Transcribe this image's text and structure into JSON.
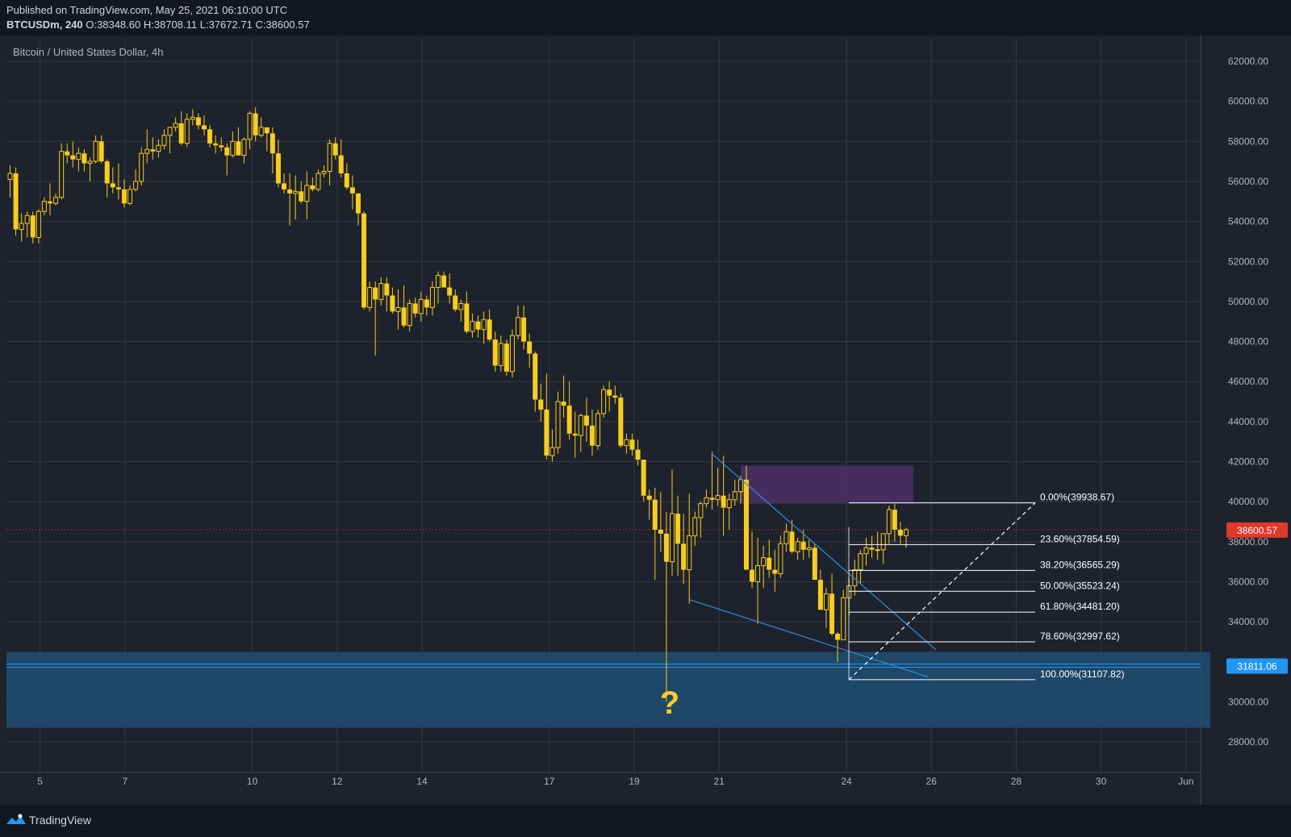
{
  "header": {
    "published": "Published on TradingView.com, May 25, 2021 06:10:00 UTC",
    "symbol": "BTCUSDm, 240",
    "o_label": "O:",
    "o": "38348.60",
    "h_label": "H:",
    "h": "38708.11",
    "l_label": "L:",
    "l": "37672.71",
    "c_label": "C:",
    "c": "38600.57"
  },
  "footer": {
    "brand": "TradingView"
  },
  "chart_data": {
    "type": "candlestick",
    "title": "Bitcoin / United States Dollar, 4h",
    "ylim": [
      27000,
      63000
    ],
    "y_ticks": [
      "62000.00",
      "60000.00",
      "58000.00",
      "56000.00",
      "54000.00",
      "52000.00",
      "50000.00",
      "48000.00",
      "46000.00",
      "44000.00",
      "42000.00",
      "40000.00",
      "38000.00",
      "36000.00",
      "34000.00",
      "32000.00",
      "30000.00",
      "28000.00"
    ],
    "x_ticks": [
      "5",
      "7",
      "10",
      "12",
      "14",
      "17",
      "19",
      "21",
      "24",
      "26",
      "28",
      "30",
      "Jun"
    ],
    "candles": [
      [
        56100,
        56800,
        55200,
        56400
      ],
      [
        56400,
        56700,
        53300,
        53600
      ],
      [
        53600,
        54400,
        53000,
        53900
      ],
      [
        53900,
        54500,
        53200,
        54300
      ],
      [
        54300,
        54500,
        52900,
        53200
      ],
      [
        53200,
        54600,
        52900,
        54500
      ],
      [
        54500,
        55200,
        54300,
        55000
      ],
      [
        55000,
        55900,
        54300,
        54900
      ],
      [
        54900,
        55400,
        54800,
        55200
      ],
      [
        55200,
        57900,
        55100,
        57500
      ],
      [
        57500,
        57900,
        56900,
        57300
      ],
      [
        57300,
        58000,
        56700,
        57100
      ],
      [
        57100,
        57700,
        56500,
        57400
      ],
      [
        57400,
        57600,
        56500,
        56900
      ],
      [
        56900,
        57200,
        56000,
        57000
      ],
      [
        57000,
        58300,
        56900,
        58000
      ],
      [
        58000,
        58300,
        56900,
        57000
      ],
      [
        57000,
        57100,
        55200,
        55900
      ],
      [
        55900,
        56700,
        55400,
        55700
      ],
      [
        55700,
        56900,
        55100,
        55600
      ],
      [
        55600,
        56100,
        54700,
        54900
      ],
      [
        54900,
        55800,
        54800,
        55600
      ],
      [
        55600,
        56600,
        55500,
        56000
      ],
      [
        56000,
        57700,
        55800,
        57400
      ],
      [
        57400,
        58600,
        56900,
        57600
      ],
      [
        57600,
        58200,
        57100,
        57500
      ],
      [
        57500,
        58100,
        57200,
        57800
      ],
      [
        57800,
        58600,
        57600,
        58300
      ],
      [
        58300,
        58700,
        57400,
        58700
      ],
      [
        58700,
        59200,
        58500,
        58900
      ],
      [
        58900,
        59500,
        57800,
        57900
      ],
      [
        57900,
        59400,
        57700,
        59100
      ],
      [
        59100,
        59600,
        58800,
        59200
      ],
      [
        59200,
        59400,
        58600,
        58800
      ],
      [
        58800,
        59300,
        58300,
        58600
      ],
      [
        58600,
        58800,
        57700,
        57900
      ],
      [
        57900,
        58300,
        57400,
        57800
      ],
      [
        57800,
        58200,
        57500,
        57700
      ],
      [
        57700,
        57900,
        56300,
        57300
      ],
      [
        57300,
        58500,
        57200,
        58000
      ],
      [
        58000,
        58700,
        57500,
        57300
      ],
      [
        57300,
        58200,
        56900,
        58100
      ],
      [
        58100,
        59500,
        57600,
        59400
      ],
      [
        59400,
        59700,
        58000,
        58300
      ],
      [
        58300,
        59200,
        58200,
        58700
      ],
      [
        58700,
        58700,
        57500,
        58400
      ],
      [
        58400,
        58700,
        56400,
        57400
      ],
      [
        57400,
        58100,
        55700,
        55900
      ],
      [
        55900,
        56400,
        55400,
        55600
      ],
      [
        55600,
        56400,
        53800,
        55400
      ],
      [
        55400,
        56300,
        54100,
        55500
      ],
      [
        55500,
        56000,
        54900,
        55000
      ],
      [
        55000,
        56500,
        54100,
        55800
      ],
      [
        55800,
        56200,
        55500,
        55600
      ],
      [
        55600,
        56600,
        55500,
        56400
      ],
      [
        56400,
        56800,
        56200,
        56500
      ],
      [
        56500,
        58100,
        55800,
        57900
      ],
      [
        57900,
        58200,
        57100,
        57300
      ],
      [
        57300,
        58100,
        56200,
        56400
      ],
      [
        56400,
        56900,
        55600,
        55700
      ],
      [
        55700,
        56300,
        54600,
        55400
      ],
      [
        55400,
        55400,
        53800,
        54400
      ],
      [
        54400,
        54500,
        49600,
        49700
      ],
      [
        49700,
        51000,
        49500,
        50700
      ],
      [
        50700,
        51000,
        47300,
        50100
      ],
      [
        50100,
        51200,
        49800,
        50900
      ],
      [
        50900,
        51200,
        49500,
        50300
      ],
      [
        50300,
        50700,
        49400,
        49500
      ],
      [
        49500,
        50600,
        48600,
        49700
      ],
      [
        49700,
        50800,
        48700,
        48800
      ],
      [
        48800,
        50100,
        48500,
        49900
      ],
      [
        49900,
        50200,
        49200,
        49400
      ],
      [
        49400,
        50500,
        49000,
        50100
      ],
      [
        50100,
        50300,
        49300,
        49700
      ],
      [
        49700,
        51000,
        49300,
        50700
      ],
      [
        50700,
        51500,
        49900,
        51300
      ],
      [
        51300,
        51500,
        50700,
        50700
      ],
      [
        50700,
        51400,
        49900,
        50300
      ],
      [
        50300,
        50600,
        49500,
        49600
      ],
      [
        49600,
        50100,
        49000,
        49900
      ],
      [
        49900,
        50500,
        48400,
        48500
      ],
      [
        48500,
        49400,
        48200,
        49000
      ],
      [
        49000,
        49300,
        48200,
        48600
      ],
      [
        48600,
        49500,
        47900,
        49100
      ],
      [
        49100,
        49600,
        48000,
        48100
      ],
      [
        48100,
        48500,
        46500,
        46800
      ],
      [
        46800,
        48300,
        46500,
        47900
      ],
      [
        47900,
        48100,
        46300,
        46500
      ],
      [
        46500,
        48600,
        46200,
        48300
      ],
      [
        48300,
        49800,
        48100,
        49200
      ],
      [
        49200,
        49800,
        47600,
        48000
      ],
      [
        48000,
        48400,
        46700,
        47400
      ],
      [
        47400,
        47500,
        44500,
        45100
      ],
      [
        45100,
        45900,
        44000,
        44600
      ],
      [
        44600,
        46400,
        42100,
        42300
      ],
      [
        42300,
        43600,
        42000,
        42700
      ],
      [
        42700,
        45500,
        42400,
        45000
      ],
      [
        45000,
        46300,
        44200,
        44800
      ],
      [
        44800,
        46000,
        43100,
        43400
      ],
      [
        43400,
        44500,
        42200,
        43300
      ],
      [
        43300,
        44400,
        42500,
        44300
      ],
      [
        44300,
        45200,
        43000,
        43800
      ],
      [
        43800,
        44600,
        42300,
        42800
      ],
      [
        42800,
        44600,
        42600,
        44400
      ],
      [
        44400,
        45800,
        44200,
        45600
      ],
      [
        45600,
        46000,
        44500,
        45300
      ],
      [
        45300,
        45800,
        44900,
        45200
      ],
      [
        45200,
        45400,
        42700,
        42800
      ],
      [
        42800,
        43400,
        42400,
        43100
      ],
      [
        43100,
        43400,
        42300,
        42600
      ],
      [
        42600,
        43100,
        41800,
        42100
      ],
      [
        42100,
        42100,
        40000,
        40300
      ],
      [
        40300,
        40600,
        39100,
        40100
      ],
      [
        40100,
        40700,
        36100,
        38600
      ],
      [
        38600,
        40500,
        37500,
        38400
      ],
      [
        38400,
        39500,
        30000,
        37000
      ],
      [
        37000,
        41600,
        36300,
        39400
      ],
      [
        39400,
        40300,
        36300,
        37900
      ],
      [
        37900,
        39400,
        35900,
        36600
      ],
      [
        36600,
        40400,
        34900,
        38300
      ],
      [
        38300,
        39500,
        37800,
        39200
      ],
      [
        39200,
        40000,
        38200,
        39900
      ],
      [
        39900,
        40600,
        39700,
        40200
      ],
      [
        40200,
        42500,
        39600,
        40100
      ],
      [
        40100,
        41700,
        39800,
        40300
      ],
      [
        40300,
        42300,
        38300,
        39700
      ],
      [
        39700,
        40400,
        38600,
        40100
      ],
      [
        40100,
        41100,
        39800,
        40500
      ],
      [
        40500,
        41300,
        39900,
        41100
      ],
      [
        41100,
        41800,
        36600,
        36600
      ],
      [
        36600,
        38500,
        35700,
        36000
      ],
      [
        36000,
        38200,
        33900,
        36800
      ],
      [
        36800,
        37800,
        35700,
        37200
      ],
      [
        37200,
        38100,
        36200,
        36600
      ],
      [
        36600,
        37600,
        35500,
        36400
      ],
      [
        36400,
        38300,
        36200,
        37900
      ],
      [
        37900,
        38900,
        37500,
        38500
      ],
      [
        38500,
        39100,
        37400,
        37500
      ],
      [
        37500,
        38200,
        37100,
        38000
      ],
      [
        38000,
        38600,
        37100,
        37600
      ],
      [
        37600,
        38100,
        37200,
        37700
      ],
      [
        37700,
        37900,
        36100,
        36100
      ],
      [
        36100,
        36600,
        34600,
        34600
      ],
      [
        34600,
        35700,
        33700,
        35400
      ],
      [
        35400,
        36400,
        33300,
        33400
      ],
      [
        33400,
        33500,
        32000,
        33100
      ],
      [
        33100,
        35600,
        33100,
        35200
      ],
      [
        35200,
        36200,
        34300,
        35800
      ],
      [
        35800,
        37100,
        35300,
        36600
      ],
      [
        36600,
        37600,
        35900,
        37400
      ],
      [
        37400,
        38200,
        36800,
        37700
      ],
      [
        37700,
        38300,
        37200,
        37600
      ],
      [
        37600,
        38500,
        37100,
        37600
      ],
      [
        37600,
        38400,
        36900,
        38400
      ],
      [
        38400,
        39800,
        37900,
        39600
      ],
      [
        39600,
        39900,
        38000,
        38600
      ],
      [
        38600,
        39000,
        37900,
        38300
      ],
      [
        38300,
        38700,
        37700,
        38600
      ]
    ],
    "last_price": "38600.57",
    "support_price": "31811.06",
    "support_zone": [
      28700,
      32500
    ],
    "resistance_zone": [
      39900,
      41800
    ],
    "annotation": "?",
    "fib_levels": [
      {
        "label": "0.00%(39938.67)",
        "price": 39938.67
      },
      {
        "label": "23.60%(37854.59)",
        "price": 37854.59
      },
      {
        "label": "38.20%(36565.29)",
        "price": 36565.29
      },
      {
        "label": "50.00%(35523.24)",
        "price": 35523.24
      },
      {
        "label": "61.80%(34481.20)",
        "price": 34481.2
      },
      {
        "label": "78.60%(32997.62)",
        "price": 32997.62
      },
      {
        "label": "100.00%(31107.82)",
        "price": 31107.82
      }
    ],
    "colors": {
      "background": "#1e222d",
      "grid": "#363a45",
      "candle": "#f7cd1e",
      "support_zone": "#1e4d73",
      "support_line": "#2196f3",
      "resistance_zone": "#4a2f63",
      "trendline": "#2f8fd8",
      "fib_line": "#ffffff",
      "last_price_bg": "#e0392d",
      "axis_text": "#b2b5be"
    }
  }
}
